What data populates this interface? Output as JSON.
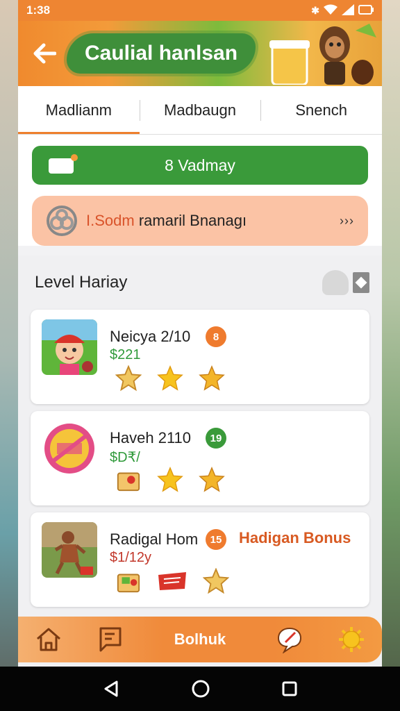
{
  "status_bar": {
    "time": "1:38"
  },
  "header": {
    "title": "Caulial hanlsan"
  },
  "tabs": [
    {
      "label": "Madlianm",
      "active": true
    },
    {
      "label": "Madbaugn",
      "active": false
    },
    {
      "label": "Snench",
      "active": false
    }
  ],
  "action_button": {
    "label": "8 Vadmay"
  },
  "promo": {
    "highlight": "I.Sodm",
    "text": " ramaril Bnanagı",
    "more": "›››"
  },
  "section": {
    "title": "Level Hariay"
  },
  "cards": [
    {
      "name": "Neicya 2/10",
      "price": "$221",
      "price_color": "#2f9a3a",
      "badge": "8",
      "badge_color": "#ef7b2e",
      "bonus": ""
    },
    {
      "name": "Haveh 2110",
      "price": "$D₹/",
      "price_color": "#2f9a3a",
      "badge": "19",
      "badge_color": "#3a9a3a",
      "bonus": ""
    },
    {
      "name": "Radigal Hom",
      "price": "$1/12y",
      "price_color": "#c2372a",
      "badge": "15",
      "badge_color": "#ef7b2e",
      "bonus": "Hadigan Bonus"
    }
  ],
  "bottom_nav": {
    "center_label": "Bolhuk"
  },
  "colors": {
    "accent_orange": "#ee8532",
    "brand_green": "#3a9a3a",
    "promo_bg": "#fbc3a5"
  }
}
